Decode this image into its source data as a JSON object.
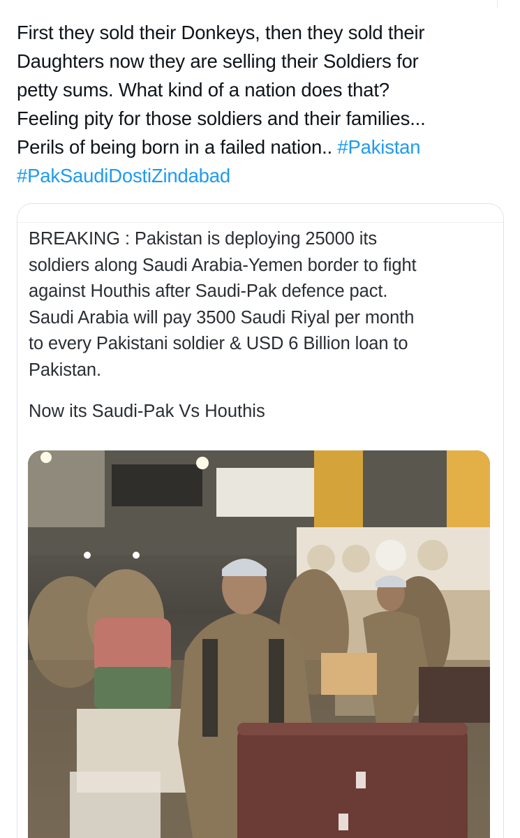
{
  "tweet": {
    "text_lines": [
      "First they sold their Donkeys, then they sold their",
      "Daughters now they are selling their Soldiers for",
      "petty sums. What kind of a nation does that?",
      "Feeling pity for those soldiers and their families...",
      "Perils of being born in a failed nation.. "
    ],
    "hashtags": [
      "#Pakistan",
      "#PakSaudiDostiZindabad"
    ]
  },
  "quoted_tweet": {
    "lines": [
      "BREAKING : Pakistan is deploying 25000 its",
      "soldiers along Saudi Arabia-Yemen border to fight",
      "against Houthis after Saudi-Pak defence pact.",
      "Saudi Arabia will pay 3500 Saudi Riyal per month",
      "to every Pakistani soldier & USD 6 Billion loan to",
      "Pakistan."
    ],
    "sub_line": "Now its Saudi-Pak Vs Houthis",
    "media": {
      "icon": "video-thumbnail",
      "colors": {
        "uniform": "#8a7659",
        "cap": "#cfd4da",
        "suitcase": "#6b3b35",
        "sign": "#e8a33a"
      }
    }
  }
}
